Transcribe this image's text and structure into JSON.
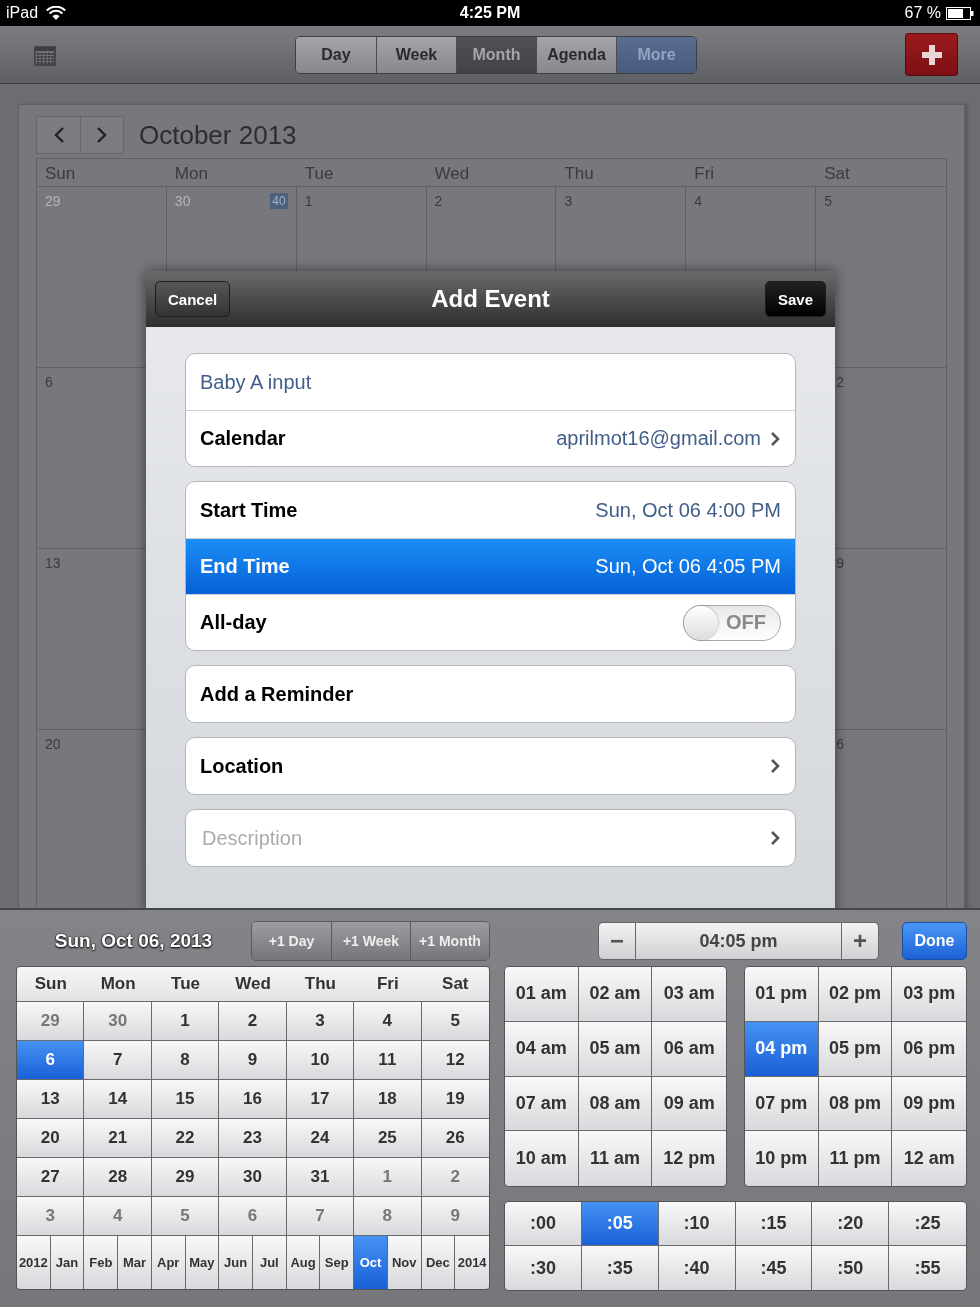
{
  "status_bar": {
    "device": "iPad",
    "time": "4:25 PM",
    "battery": "67 %"
  },
  "toolbar": {
    "views": [
      {
        "label": "Day",
        "selected": false,
        "accent": false
      },
      {
        "label": "Week",
        "selected": false,
        "accent": false
      },
      {
        "label": "Month",
        "selected": true,
        "accent": false
      },
      {
        "label": "Agenda",
        "selected": false,
        "accent": false
      },
      {
        "label": "More",
        "selected": false,
        "accent": true
      }
    ]
  },
  "calendar": {
    "title": "October 2013",
    "weekdays": [
      "Sun",
      "Mon",
      "Tue",
      "Wed",
      "Thu",
      "Fri",
      "Sat"
    ],
    "first_week": {
      "week_number": "40",
      "days": [
        {
          "label": "29",
          "outside": true
        },
        {
          "label": "30",
          "outside": true
        },
        {
          "label": "1",
          "outside": false
        },
        {
          "label": "2",
          "outside": false
        },
        {
          "label": "3",
          "outside": false
        },
        {
          "label": "4",
          "outside": false
        },
        {
          "label": "5",
          "outside": false
        }
      ]
    },
    "later_weeks": [
      {
        "first": "6",
        "last": "2"
      },
      {
        "first": "13",
        "last": "9"
      },
      {
        "first": "20",
        "last": "6"
      }
    ]
  },
  "modal": {
    "title": "Add Event",
    "cancel": "Cancel",
    "save": "Save",
    "groups": [
      {
        "rows": [
          {
            "kind": "input",
            "value": "Baby A input"
          },
          {
            "kind": "disclosure",
            "label": "Calendar",
            "value": "aprilmot16@gmail.com"
          }
        ]
      },
      {
        "rows": [
          {
            "kind": "value",
            "label": "Start Time",
            "value": "Sun, Oct 06 4:00 PM",
            "selected": false
          },
          {
            "kind": "value",
            "label": "End Time",
            "value": "Sun, Oct 06 4:05 PM",
            "selected": true
          },
          {
            "kind": "toggle",
            "label": "All-day",
            "on": false,
            "toggle_text": "OFF"
          }
        ]
      },
      {
        "rows": [
          {
            "kind": "plain",
            "label": "Add a Reminder"
          }
        ]
      },
      {
        "rows": [
          {
            "kind": "disclosure",
            "label": "Location"
          }
        ]
      },
      {
        "rows": [
          {
            "kind": "placeholder",
            "placeholder": "Description"
          }
        ]
      }
    ]
  },
  "picker": {
    "date": "Sun, Oct 06, 2013",
    "steps": [
      "+1 Day",
      "+1 Week",
      "+1 Month"
    ],
    "weekdays": [
      "Sun",
      "Mon",
      "Tue",
      "Wed",
      "Thu",
      "Fri",
      "Sat"
    ],
    "weeks": [
      [
        {
          "label": "29",
          "outside": true,
          "selected": false
        },
        {
          "label": "30",
          "outside": true,
          "selected": false
        },
        {
          "label": "1",
          "outside": false,
          "selected": false
        },
        {
          "label": "2",
          "outside": false,
          "selected": false
        },
        {
          "label": "3",
          "outside": false,
          "selected": false
        },
        {
          "label": "4",
          "outside": false,
          "selected": false
        },
        {
          "label": "5",
          "outside": false,
          "selected": false
        }
      ],
      [
        {
          "label": "6",
          "outside": false,
          "selected": true
        },
        {
          "label": "7",
          "outside": false,
          "selected": false
        },
        {
          "label": "8",
          "outside": false,
          "selected": false
        },
        {
          "label": "9",
          "outside": false,
          "selected": false
        },
        {
          "label": "10",
          "outside": false,
          "selected": false
        },
        {
          "label": "11",
          "outside": false,
          "selected": false
        },
        {
          "label": "12",
          "outside": false,
          "selected": false
        }
      ],
      [
        {
          "label": "13",
          "outside": false,
          "selected": false
        },
        {
          "label": "14",
          "outside": false,
          "selected": false
        },
        {
          "label": "15",
          "outside": false,
          "selected": false
        },
        {
          "label": "16",
          "outside": false,
          "selected": false
        },
        {
          "label": "17",
          "outside": false,
          "selected": false
        },
        {
          "label": "18",
          "outside": false,
          "selected": false
        },
        {
          "label": "19",
          "outside": false,
          "selected": false
        }
      ],
      [
        {
          "label": "20",
          "outside": false,
          "selected": false
        },
        {
          "label": "21",
          "outside": false,
          "selected": false
        },
        {
          "label": "22",
          "outside": false,
          "selected": false
        },
        {
          "label": "23",
          "outside": false,
          "selected": false
        },
        {
          "label": "24",
          "outside": false,
          "selected": false
        },
        {
          "label": "25",
          "outside": false,
          "selected": false
        },
        {
          "label": "26",
          "outside": false,
          "selected": false
        }
      ],
      [
        {
          "label": "27",
          "outside": false,
          "selected": false
        },
        {
          "label": "28",
          "outside": false,
          "selected": false
        },
        {
          "label": "29",
          "outside": false,
          "selected": false
        },
        {
          "label": "30",
          "outside": false,
          "selected": false
        },
        {
          "label": "31",
          "outside": false,
          "selected": false
        },
        {
          "label": "1",
          "outside": true,
          "selected": false
        },
        {
          "label": "2",
          "outside": true,
          "selected": false
        }
      ],
      [
        {
          "label": "3",
          "outside": true,
          "selected": false
        },
        {
          "label": "4",
          "outside": true,
          "selected": false
        },
        {
          "label": "5",
          "outside": true,
          "selected": false
        },
        {
          "label": "6",
          "outside": true,
          "selected": false
        },
        {
          "label": "7",
          "outside": true,
          "selected": false
        },
        {
          "label": "8",
          "outside": true,
          "selected": false
        },
        {
          "label": "9",
          "outside": true,
          "selected": false
        }
      ]
    ],
    "months": [
      {
        "label": "2012",
        "selected": false
      },
      {
        "label": "Jan",
        "selected": false
      },
      {
        "label": "Feb",
        "selected": false
      },
      {
        "label": "Mar",
        "selected": false
      },
      {
        "label": "Apr",
        "selected": false
      },
      {
        "label": "May",
        "selected": false
      },
      {
        "label": "Jun",
        "selected": false
      },
      {
        "label": "Jul",
        "selected": false
      },
      {
        "label": "Aug",
        "selected": false
      },
      {
        "label": "Sep",
        "selected": false
      },
      {
        "label": "Oct",
        "selected": true
      },
      {
        "label": "Nov",
        "selected": false
      },
      {
        "label": "Dec",
        "selected": false
      },
      {
        "label": "2014",
        "selected": false
      }
    ],
    "minus": "−",
    "time": "04:05 pm",
    "plus": "+",
    "done": "Done",
    "am_hours": [
      {
        "label": "01 am",
        "selected": false
      },
      {
        "label": "02 am",
        "selected": false
      },
      {
        "label": "03 am",
        "selected": false
      },
      {
        "label": "04 am",
        "selected": false
      },
      {
        "label": "05 am",
        "selected": false
      },
      {
        "label": "06 am",
        "selected": false
      },
      {
        "label": "07 am",
        "selected": false
      },
      {
        "label": "08 am",
        "selected": false
      },
      {
        "label": "09 am",
        "selected": false
      },
      {
        "label": "10 am",
        "selected": false
      },
      {
        "label": "11 am",
        "selected": false
      },
      {
        "label": "12 pm",
        "selected": false
      }
    ],
    "pm_hours": [
      {
        "label": "01 pm",
        "selected": false
      },
      {
        "label": "02 pm",
        "selected": false
      },
      {
        "label": "03 pm",
        "selected": false
      },
      {
        "label": "04 pm",
        "selected": true
      },
      {
        "label": "05 pm",
        "selected": false
      },
      {
        "label": "06 pm",
        "selected": false
      },
      {
        "label": "07 pm",
        "selected": false
      },
      {
        "label": "08 pm",
        "selected": false
      },
      {
        "label": "09 pm",
        "selected": false
      },
      {
        "label": "10 pm",
        "selected": false
      },
      {
        "label": "11 pm",
        "selected": false
      },
      {
        "label": "12 am",
        "selected": false
      }
    ],
    "minutes": [
      {
        "label": ":00",
        "selected": false
      },
      {
        "label": ":05",
        "selected": true
      },
      {
        "label": ":10",
        "selected": false
      },
      {
        "label": ":15",
        "selected": false
      },
      {
        "label": ":20",
        "selected": false
      },
      {
        "label": ":25",
        "selected": false
      },
      {
        "label": ":30",
        "selected": false
      },
      {
        "label": ":35",
        "selected": false
      },
      {
        "label": ":40",
        "selected": false
      },
      {
        "label": ":45",
        "selected": false
      },
      {
        "label": ":50",
        "selected": false
      },
      {
        "label": ":55",
        "selected": false
      }
    ]
  }
}
